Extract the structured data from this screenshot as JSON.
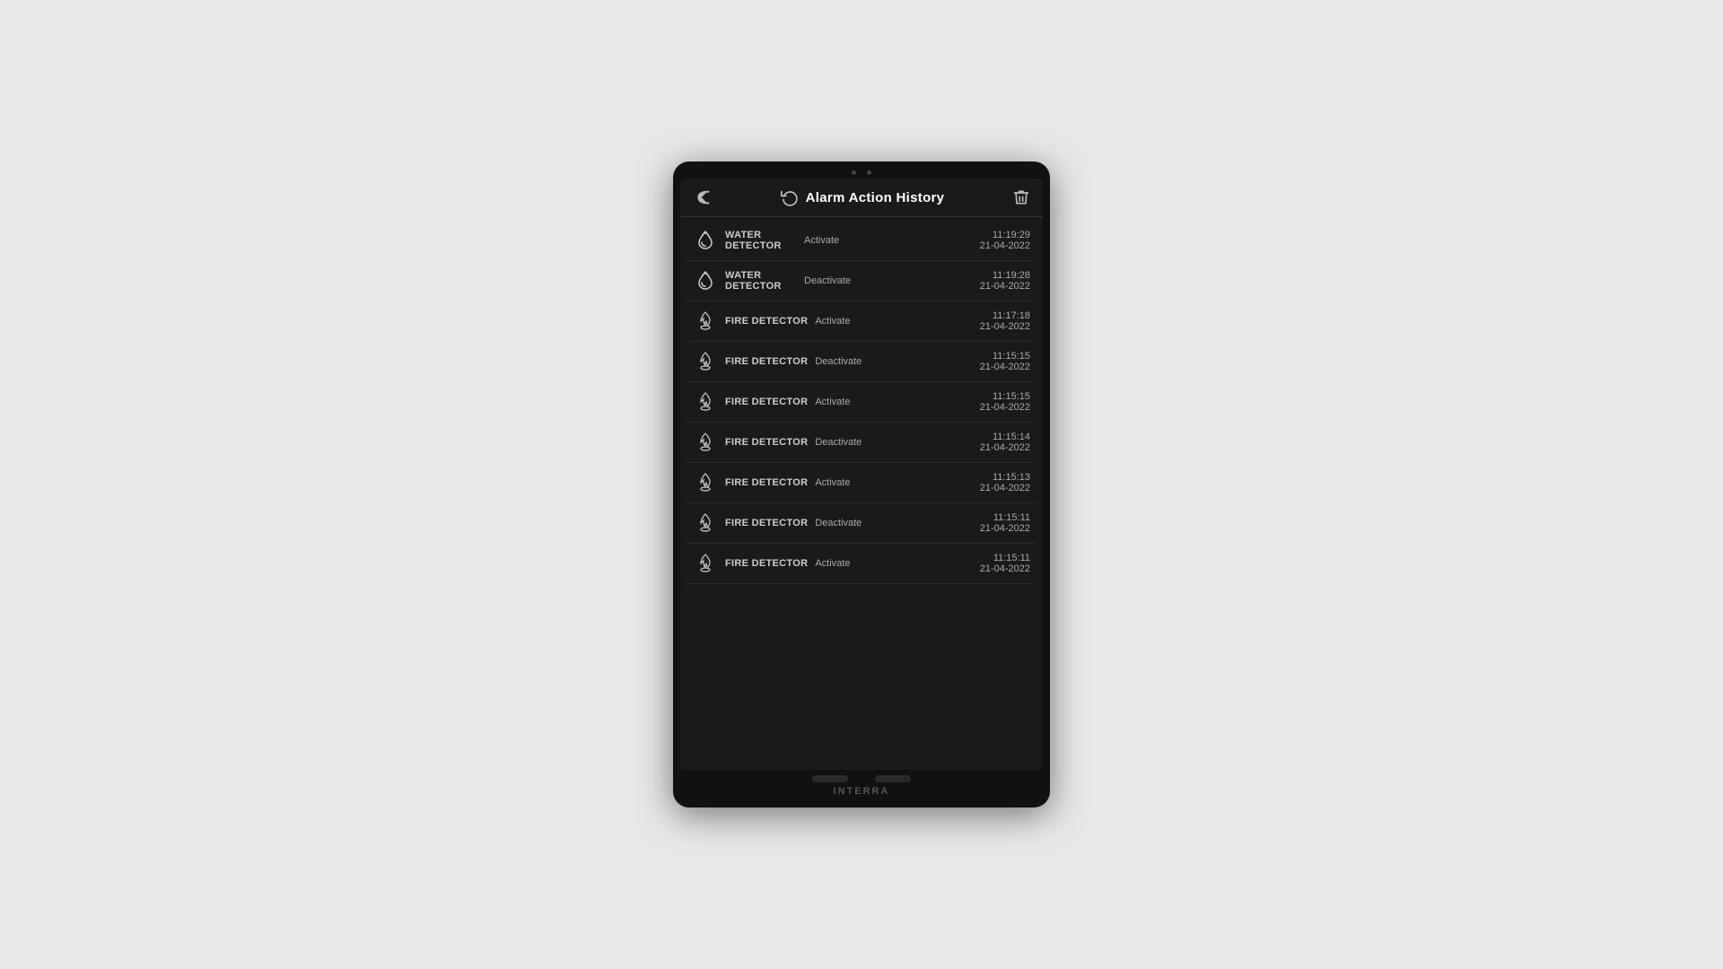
{
  "device": {
    "brand": "INTERRA"
  },
  "header": {
    "title": "Alarm Action History",
    "back_label": "back",
    "refresh_label": "refresh",
    "delete_label": "delete"
  },
  "history": {
    "items": [
      {
        "id": 1,
        "type": "water",
        "name": "WATER\nDETECTOR",
        "name_line1": "WATER",
        "name_line2": "DETECTOR",
        "action": "Activate",
        "time": "11:19:29",
        "date": "21-04-2022"
      },
      {
        "id": 2,
        "type": "water",
        "name": "WATER\nDETECTOR",
        "name_line1": "WATER",
        "name_line2": "DETECTOR",
        "action": "Deactivate",
        "time": "11:19:28",
        "date": "21-04-2022"
      },
      {
        "id": 3,
        "type": "fire",
        "name": "FIRE DETECTOR",
        "name_line1": "FIRE DETECTOR",
        "name_line2": "",
        "action": "Activate",
        "time": "11:17:18",
        "date": "21-04-2022"
      },
      {
        "id": 4,
        "type": "fire",
        "name": "FIRE DETECTOR",
        "name_line1": "FIRE DETECTOR",
        "name_line2": "",
        "action": "Deactivate",
        "time": "11:15:15",
        "date": "21-04-2022"
      },
      {
        "id": 5,
        "type": "fire",
        "name": "FIRE DETECTOR",
        "name_line1": "FIRE DETECTOR",
        "name_line2": "",
        "action": "Activate",
        "time": "11:15:15",
        "date": "21-04-2022"
      },
      {
        "id": 6,
        "type": "fire",
        "name": "FIRE DETECTOR",
        "name_line1": "FIRE DETECTOR",
        "name_line2": "",
        "action": "Deactivate",
        "time": "11:15:14",
        "date": "21-04-2022"
      },
      {
        "id": 7,
        "type": "fire",
        "name": "FIRE DETECTOR",
        "name_line1": "FIRE DETECTOR",
        "name_line2": "",
        "action": "Activate",
        "time": "11:15:13",
        "date": "21-04-2022"
      },
      {
        "id": 8,
        "type": "fire",
        "name": "FIRE DETECTOR",
        "name_line1": "FIRE DETECTOR",
        "name_line2": "",
        "action": "Deactivate",
        "time": "11:15:11",
        "date": "21-04-2022"
      },
      {
        "id": 9,
        "type": "fire",
        "name": "FIRE DETECTOR",
        "name_line1": "FIRE DETECTOR",
        "name_line2": "",
        "action": "Activate",
        "time": "11:15:11",
        "date": "21-04-2022"
      }
    ]
  }
}
